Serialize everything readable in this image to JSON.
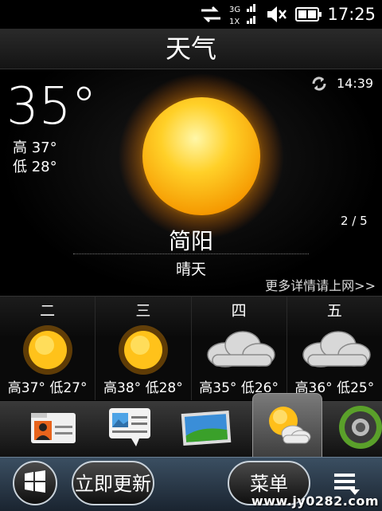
{
  "status": {
    "network_label": "3G",
    "network_sub": "1X",
    "time": "17:25"
  },
  "title": "天气",
  "current": {
    "temp": "35°",
    "high": "高 37°",
    "low": "低 28°",
    "updated_time": "14:39",
    "page_indicator": "2 / 5",
    "city": "简阳",
    "condition": "晴天",
    "more_link": "更多详情请上网>>",
    "icon": "sun-icon"
  },
  "forecast": [
    {
      "day": "二",
      "range": "高37° 低27°",
      "icon": "sun-icon"
    },
    {
      "day": "三",
      "range": "高38° 低28°",
      "icon": "sun-icon"
    },
    {
      "day": "四",
      "range": "高35° 低26°",
      "icon": "cloud-icon"
    },
    {
      "day": "五",
      "range": "高36° 低25°",
      "icon": "cloud-icon"
    }
  ],
  "tabs": [
    "contacts-icon",
    "messages-icon",
    "photos-icon",
    "weather-icon",
    "settings-icon"
  ],
  "bottom": {
    "refresh_label": "立即更新",
    "menu_label": "菜单"
  },
  "watermark": "www.jy0282.com",
  "colors": {
    "accent_sun": "#ffc21a",
    "bottom_bar": "#2b3a4a"
  }
}
